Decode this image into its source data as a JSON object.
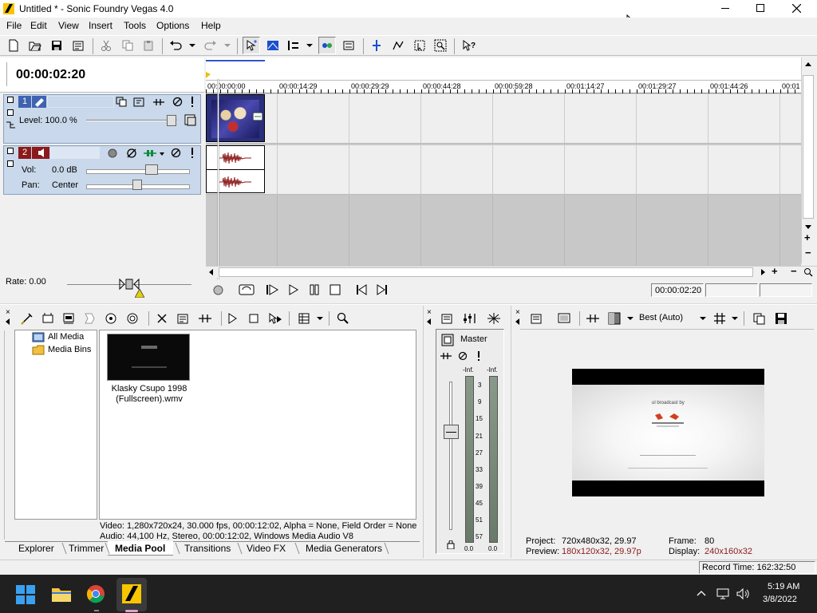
{
  "window": {
    "title": "Untitled * - Sonic Foundry Vegas 4.0"
  },
  "menu": [
    "File",
    "Edit",
    "View",
    "Insert",
    "Tools",
    "Options",
    "Help"
  ],
  "toolbar_icons": [
    "new-icon",
    "open-icon",
    "save-icon",
    "properties-icon",
    "cut-icon",
    "copy-icon",
    "paste-icon",
    "undo-icon",
    "redo-icon",
    "normal-edit-tool-icon",
    "envelope-tool-icon",
    "snapping-icon",
    "auto-ripple-icon",
    "lock-envelopes-icon",
    "ignore-grouping-icon",
    "selection-tool-icon",
    "zoom-tool-icon",
    "whats-this-help-icon"
  ],
  "timecode": "00:00:02:20",
  "ruler": [
    "00:00:00:00",
    "00:00:14:29",
    "00:00:29:29",
    "00:00:44:28",
    "00:00:59:28",
    "00:01:14:27",
    "00:01:29:27",
    "00:01:44:26",
    "00:01"
  ],
  "video_track": {
    "number": "1",
    "level_label": "Level: 100.0 %",
    "level": 1.0
  },
  "audio_track": {
    "number": "2",
    "vol_label": "Vol:",
    "vol_value": "0.0 dB",
    "pan_label": "Pan:",
    "pan_value": "Center"
  },
  "rate": {
    "label": "Rate: 0.00"
  },
  "transport": {
    "time": "00:00:02:20"
  },
  "media_pool": {
    "tree": [
      "All Media",
      "Media Bins"
    ],
    "file_name": "Klasky Csupo 1998 (Fullscreen).wmv",
    "info_video": "Video: 1,280x720x24, 30.000 fps, 00:00:12:02, Alpha = None, Field Order = None (p",
    "info_audio": "Audio: 44,100 Hz, Stereo, 00:00:12:02, Windows Media Audio V8"
  },
  "tabs": [
    "Explorer",
    "Trimmer",
    "Media Pool",
    "Transitions",
    "Video FX",
    "Media Generators"
  ],
  "active_tab": "Media Pool",
  "mixer": {
    "master_label": "Master",
    "inf_left": "-Inf.",
    "inf_right": "-Inf.",
    "scale": [
      "3",
      "9",
      "15",
      "21",
      "27",
      "33",
      "39",
      "45",
      "51",
      "57"
    ],
    "bottom_left": "0.0",
    "bottom_right": "0.0"
  },
  "preview": {
    "quality": "Best (Auto)",
    "project_label": "Project:",
    "project_value": "720x480x32, 29.97",
    "preview_label": "Preview:",
    "preview_value": "180x120x32, 29.97p",
    "frame_label": "Frame:",
    "frame_value": "80",
    "display_label": "Display:",
    "display_value": "240x160x32",
    "overlay_text": "ul broadcast by"
  },
  "status": {
    "record_time": "Record Time: 162:32:50"
  },
  "taskbar": {
    "time": "5:19 AM",
    "date": "3/8/2022"
  },
  "colors": {
    "track_panel": "#c9d8ea",
    "selected_tab": "#ffffff",
    "accent_red": "#8b1a1a",
    "taskbar": "#202020"
  }
}
